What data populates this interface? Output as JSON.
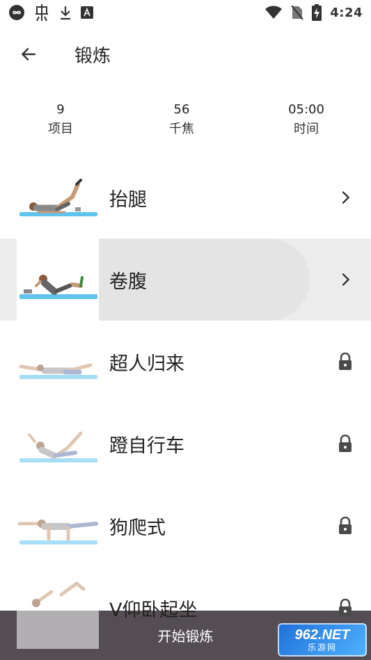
{
  "status_bar": {
    "time": "4:24",
    "left_icons": [
      "infinity-icon",
      "bug-icon",
      "download-icon",
      "font-icon"
    ],
    "right_icons": [
      "wifi-icon",
      "no-sim-icon",
      "battery-charging-icon"
    ]
  },
  "toolbar": {
    "title": "锻炼"
  },
  "stats": [
    {
      "value": "9",
      "label": "项目"
    },
    {
      "value": "56",
      "label": "千焦"
    },
    {
      "value": "05:00",
      "label": "时间"
    }
  ],
  "exercises": [
    {
      "name": "抬腿",
      "locked": false,
      "action_icon": "chevron-right-icon"
    },
    {
      "name": "卷腹",
      "locked": false,
      "action_icon": "chevron-right-icon"
    },
    {
      "name": "超人归来",
      "locked": true,
      "action_icon": "lock-icon"
    },
    {
      "name": "蹬自行车",
      "locked": true,
      "action_icon": "lock-icon"
    },
    {
      "name": "狗爬式",
      "locked": true,
      "action_icon": "lock-icon"
    },
    {
      "name": "V仰卧起坐",
      "locked": true,
      "action_icon": "lock-icon"
    }
  ],
  "bottom_button": {
    "label": "开始锻炼"
  },
  "watermark": {
    "top": "962.NET",
    "bottom": "乐游网"
  },
  "colors": {
    "bottom_bar": "#554d54",
    "mat": "#5ec4ee",
    "active_row": "#ececec",
    "text": "#222222"
  }
}
